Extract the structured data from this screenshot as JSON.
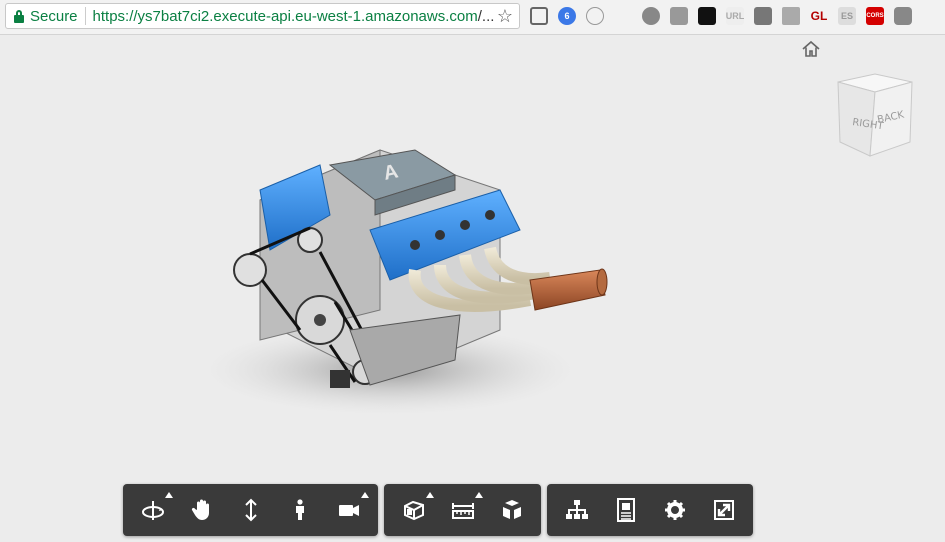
{
  "browser": {
    "security_label": "Secure",
    "url_scheme_host": "https://ys7bat7ci2.execute-api.eu-west-1.amazonaws.com",
    "url_rest": "/...",
    "extensions": [
      {
        "name": "cast-icon",
        "label": ""
      },
      {
        "name": "gear-extension-icon",
        "label": "6"
      },
      {
        "name": "code-extension-icon",
        "label": ""
      },
      {
        "name": "ship-extension-icon",
        "label": ""
      },
      {
        "name": "react-extension-icon",
        "label": ""
      },
      {
        "name": "angular-extension-icon",
        "label": ""
      },
      {
        "name": "news-extension-icon",
        "label": ""
      },
      {
        "name": "url-extension-icon",
        "label": "URL"
      },
      {
        "name": "panels-extension-icon",
        "label": ""
      },
      {
        "name": "drive-extension-icon",
        "label": ""
      },
      {
        "name": "gl-extension-icon",
        "label": "GL"
      },
      {
        "name": "es-extension-icon",
        "label": "ES"
      },
      {
        "name": "cors-extension-icon",
        "label": "CORS"
      },
      {
        "name": "box-extension-icon",
        "label": ""
      }
    ]
  },
  "viewer": {
    "viewcube": {
      "right_label": "RIGHT",
      "back_label": "BACK"
    },
    "toolbar": {
      "navigation_tools": [
        "orbit-tool",
        "pan-tool",
        "dolly-tool",
        "first-person-tool",
        "camera-tool"
      ],
      "modeling_tools": [
        "section-tool",
        "measure-tool",
        "explode-tool"
      ],
      "settings_tools": [
        "model-browser-tool",
        "properties-tool",
        "settings-tool",
        "fullscreen-tool"
      ]
    }
  },
  "colors": {
    "accent_blue": "#2f8fe8",
    "toolbar_bg": "#3a3a3a",
    "secure_green": "#0b8043"
  }
}
